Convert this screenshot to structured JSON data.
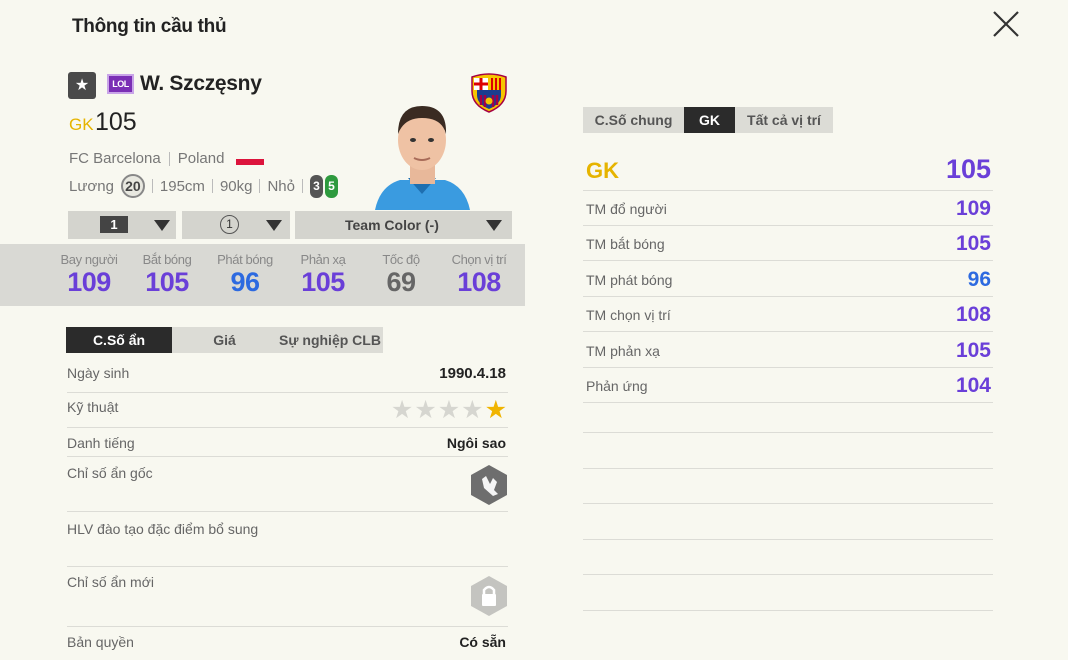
{
  "header": {
    "title": "Thông tin cầu thủ",
    "close_icon": "close-icon"
  },
  "player": {
    "name": "W. Szczęsny",
    "season_badge": "LOL",
    "position": "GK",
    "ovr": "105",
    "club": "FC Barcelona",
    "nation": "Poland",
    "salary_label": "Lương",
    "salary": "20",
    "height": "195cm",
    "weight": "90kg",
    "body_type": "Nhỏ",
    "weak_foot_left": "3",
    "weak_foot_right": "5"
  },
  "selectors": {
    "level": "1",
    "enhance": "1",
    "team_color": "Team Color (-)"
  },
  "main_stats": [
    {
      "label": "Bay người",
      "value": "109",
      "color": "#6a3fd8"
    },
    {
      "label": "Bắt bóng",
      "value": "105",
      "color": "#6a3fd8"
    },
    {
      "label": "Phát bóng",
      "value": "96",
      "color": "#2d6ae0"
    },
    {
      "label": "Phản xạ",
      "value": "105",
      "color": "#6a3fd8"
    },
    {
      "label": "Tốc độ",
      "value": "69",
      "color": "#666666"
    },
    {
      "label": "Chọn vị trí",
      "value": "108",
      "color": "#6a3fd8"
    }
  ],
  "left_tabs": [
    "C.Số ẩn",
    "Giá",
    "Sự nghiệp CLB"
  ],
  "details": {
    "birth_label": "Ngày sinh",
    "birth": "1990.4.18",
    "skill_label": "Kỹ thuật",
    "skill_stars": 1,
    "skill_max": 5,
    "rep_label": "Danh tiếng",
    "rep": "Ngôi sao",
    "hidden_label": "Chỉ số ẩn gốc",
    "coach_label": "HLV đào tạo đặc điểm bổ sung",
    "new_hidden_label": "Chỉ số ẩn mới",
    "license_label": "Bản quyền",
    "license": "Có sẵn"
  },
  "right_tabs": [
    "C.Số chung",
    "GK",
    "Tất cả vị trí"
  ],
  "right_stats": {
    "pos": "GK",
    "pos_value": "105",
    "rows": [
      {
        "label": "TM đổ người",
        "value": "109",
        "color": "#6a3fd8"
      },
      {
        "label": "TM bắt bóng",
        "value": "105",
        "color": "#6a3fd8"
      },
      {
        "label": "TM phát bóng",
        "value": "96",
        "color": "#2d6ae0"
      },
      {
        "label": "TM chọn vị trí",
        "value": "108",
        "color": "#6a3fd8"
      },
      {
        "label": "TM phản xạ",
        "value": "105",
        "color": "#6a3fd8"
      },
      {
        "label": "Phản ứng",
        "value": "104",
        "color": "#6a3fd8"
      }
    ]
  },
  "colors": {
    "gold": "#e6b400",
    "purple": "#6a3fd8",
    "blue": "#2d6ae0"
  }
}
